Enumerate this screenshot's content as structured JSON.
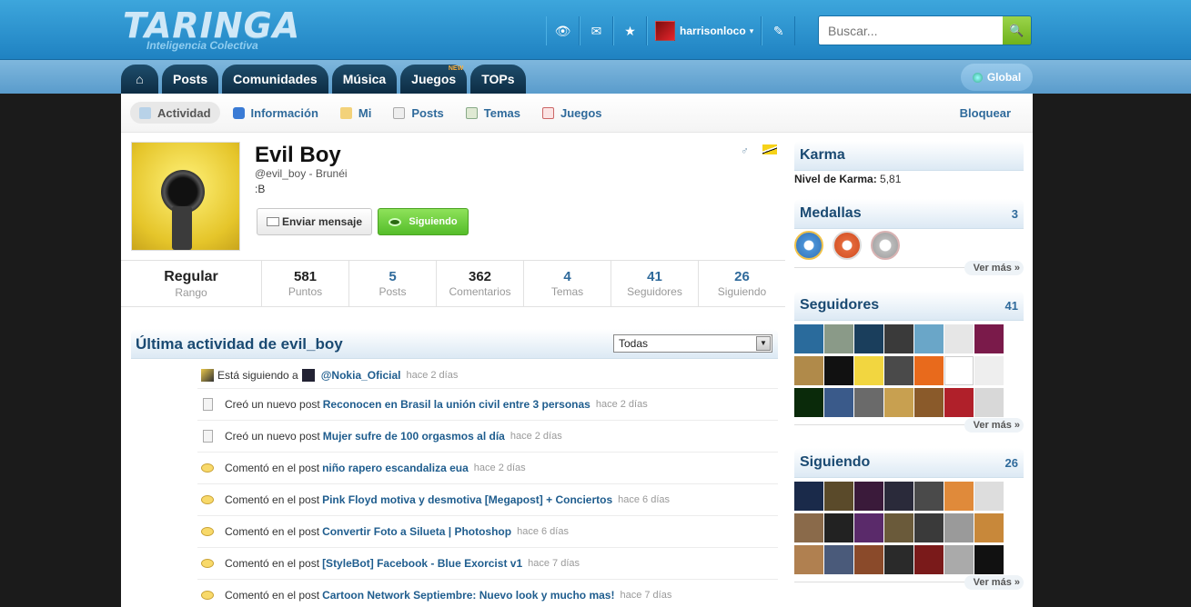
{
  "header": {
    "logo_text": "TARINGA",
    "logo_sub": "Inteligencia Colectiva",
    "username": "harrisonloco",
    "search_placeholder": "Buscar..."
  },
  "nav": {
    "tabs": [
      "Posts",
      "Comunidades",
      "Música",
      "Juegos",
      "TOPs"
    ],
    "new_badge": "NEW",
    "global": "Global"
  },
  "subnav": {
    "tabs": [
      "Actividad",
      "Información",
      "Mi",
      "Posts",
      "Temas",
      "Juegos"
    ],
    "block": "Bloquear"
  },
  "profile": {
    "name": "Evil Boy",
    "handle": "@evil_boy - Brunéi",
    "message": ":B",
    "send_message": "Enviar mensaje",
    "following": "Siguiendo"
  },
  "stats": [
    {
      "value": "Regular",
      "label": "Rango"
    },
    {
      "value": "581",
      "label": "Puntos"
    },
    {
      "value": "5",
      "label": "Posts"
    },
    {
      "value": "362",
      "label": "Comentarios"
    },
    {
      "value": "4",
      "label": "Temas"
    },
    {
      "value": "41",
      "label": "Seguidores"
    },
    {
      "value": "26",
      "label": "Siguiendo"
    }
  ],
  "activity": {
    "title": "Última actividad de evil_boy",
    "filter": "Todas",
    "items": [
      {
        "pre": "Está siguiendo a",
        "link": "@Nokia_Oficial",
        "time": "hace 2 días"
      },
      {
        "pre": "Creó un nuevo post",
        "link": "Reconocen en Brasil la unión civil entre 3 personas",
        "time": "hace 2 días"
      },
      {
        "pre": "Creó un nuevo post",
        "link": "Mujer sufre de 100 orgasmos al día",
        "time": "hace 2 días"
      },
      {
        "pre": "Comentó en el post",
        "link": "niño rapero escandaliza eua",
        "time": "hace 2 días"
      },
      {
        "pre": "Comentó en el post",
        "link": "Pink Floyd motiva y desmotiva [Megapost] + Conciertos",
        "time": "hace 6 días"
      },
      {
        "pre": "Comentó en el post",
        "link": "Convertir Foto a Silueta | Photoshop",
        "time": "hace 6 días"
      },
      {
        "pre": "Comentó en el post",
        "link": "[StyleBot] Facebook - Blue Exorcist v1",
        "time": "hace 7 días"
      },
      {
        "pre": "Comentó en el post",
        "link": "Cartoon Network Septiembre: Nuevo look y mucho mas!",
        "time": "hace 7 días"
      }
    ]
  },
  "sidebar": {
    "karma": {
      "title": "Karma",
      "label": "Nivel de Karma:",
      "value": "5,81"
    },
    "medals": {
      "title": "Medallas",
      "count": "3"
    },
    "followers": {
      "title": "Seguidores",
      "count": "41"
    },
    "following": {
      "title": "Siguiendo",
      "count": "26"
    },
    "ver_mas": "Ver más »"
  },
  "colors": {
    "header_blue": "#2a91cf",
    "nav_dark": "#0d2d44",
    "link_blue": "#1f5d8e",
    "follow_green": "#62c533"
  }
}
